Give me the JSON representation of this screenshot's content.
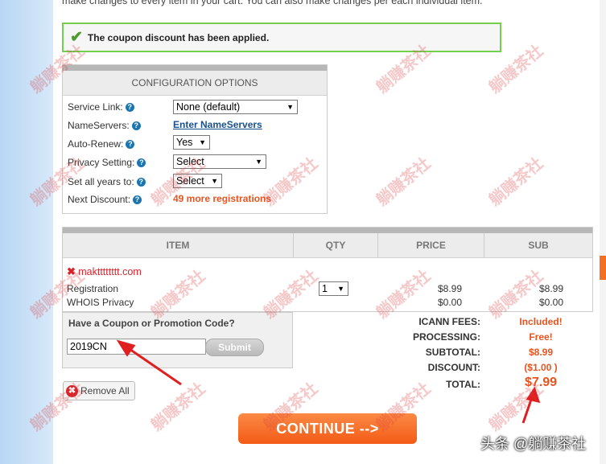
{
  "intro_text": "make changes to every item in your cart. You can also make changes per each individual item.",
  "success_message": "The coupon discount has been applied.",
  "config": {
    "title": "CONFIGURATION OPTIONS",
    "rows": [
      {
        "label": "Service Link:",
        "value": "None (default)"
      },
      {
        "label": "NameServers:",
        "value": "Enter NameServers"
      },
      {
        "label": "Auto-Renew:",
        "value": "Yes"
      },
      {
        "label": "Privacy Setting:",
        "value": "Select"
      },
      {
        "label": "Set all years to:",
        "value": "Select"
      },
      {
        "label": "Next Discount:",
        "value": "49 more registrations"
      }
    ]
  },
  "cart": {
    "columns": [
      "ITEM",
      "QTY",
      "PRICE",
      "SUB"
    ],
    "domain": "maktttttttt.com",
    "rows": [
      {
        "name": "Registration",
        "qty": "1",
        "price": "$8.99",
        "sub": "$8.99"
      },
      {
        "name": "WHOIS Privacy",
        "price": "$0.00",
        "sub": "$0.00"
      }
    ]
  },
  "coupon": {
    "title": "Have a Coupon or Promotion Code?",
    "value": "2019CN",
    "submit_label": "Submit"
  },
  "totals": [
    {
      "label": "ICANN FEES:",
      "value": "Included!"
    },
    {
      "label": "PROCESSING:",
      "value": "Free!"
    },
    {
      "label": "SUBTOTAL:",
      "value": "$8.99"
    },
    {
      "label": "DISCOUNT:",
      "value": "($1.00 )"
    },
    {
      "label": "TOTAL:",
      "value": "$7.99"
    }
  ],
  "remove_all_label": "Remove All",
  "continue_label": "CONTINUE -->",
  "watermark_text": "躺赚茶社",
  "credit_text": "头条 @躺赚茶社",
  "colors": {
    "accent": "#f35b16",
    "success_border": "#74d04c",
    "link": "#1a4f8c",
    "error": "#d9222a"
  }
}
